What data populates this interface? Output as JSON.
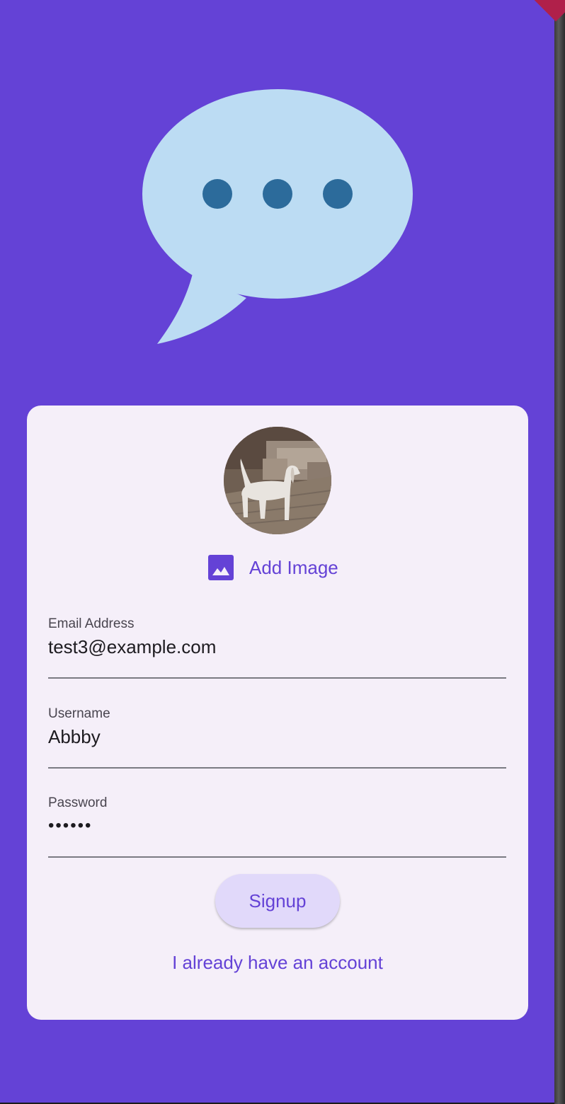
{
  "colors": {
    "background": "#6442d6",
    "card": "#f5eff9",
    "accent": "#6442d6",
    "bubble": "#bcdcf3",
    "bubble_dots": "#2c6b9b",
    "button_bg": "#e1d9fa"
  },
  "logo": {
    "icon": "chat-bubble-icon"
  },
  "avatar": {
    "description": "dog-photo"
  },
  "add_image": {
    "icon": "image-icon",
    "label": "Add Image"
  },
  "form": {
    "email": {
      "label": "Email Address",
      "value": "test3@example.com"
    },
    "username": {
      "label": "Username",
      "value": "Abbby"
    },
    "password": {
      "label": "Password",
      "value": "••••••"
    },
    "signup_label": "Signup",
    "login_link": "I already have an account"
  }
}
